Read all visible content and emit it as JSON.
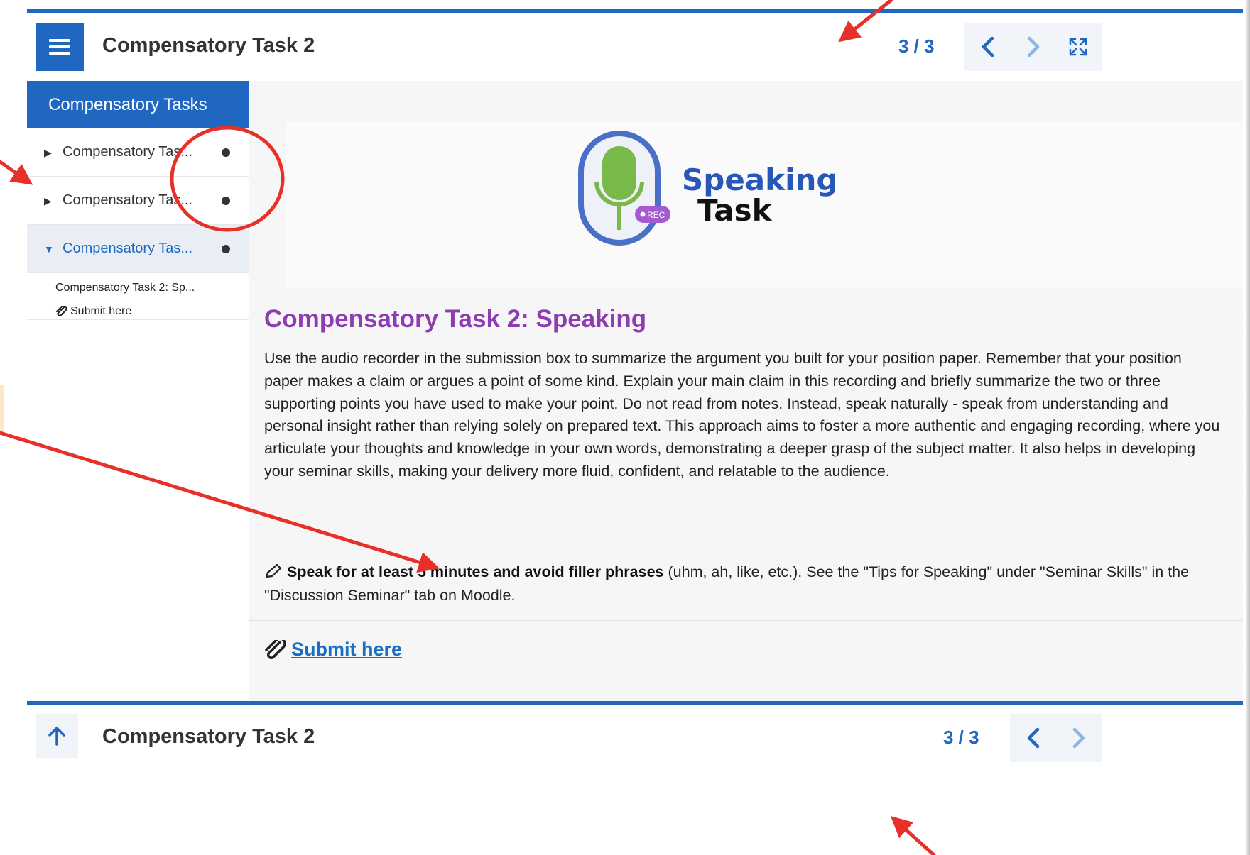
{
  "header": {
    "menu_icon": "hamburger-menu-icon",
    "title": "Compensatory Task 2",
    "page_indicator": "3 / 3",
    "prev_icon": "chevron-left-icon",
    "next_icon": "chevron-right-icon",
    "fullscreen_icon": "expand-arrows-icon"
  },
  "sidebar": {
    "heading": "Compensatory Tasks",
    "items": [
      {
        "label": "Compensatory Tas...",
        "expanded": false
      },
      {
        "label": "Compensatory Tas...",
        "expanded": false
      },
      {
        "label": "Compensatory Tas...",
        "expanded": true
      }
    ],
    "sub_items": [
      {
        "label": "Compensatory Task 2: Sp..."
      },
      {
        "label": "Submit here",
        "icon": "paperclip-icon"
      }
    ]
  },
  "banner": {
    "line1": "Speaking",
    "line2": "Task",
    "rec_badge": "REC"
  },
  "content": {
    "title": "Compensatory Task 2: Speaking",
    "body": "Use the audio recorder in the submission box to summarize the argument you built for your position paper. Remember that your position paper makes a claim or argues a point of some kind. Explain your main claim in this recording and briefly summarize the two or three supporting points you have used to make your point. Do not read from notes. Instead, speak naturally - speak from understanding and personal insight rather than relying solely on prepared text. This approach aims to foster a more authentic and engaging recording, where you articulate your thoughts and knowledge in your own words, demonstrating a deeper grasp of the subject matter. It also helps in developing your seminar skills, making your delivery more fluid, confident, and relatable to the audience.",
    "note_bold": "Speak for at least 5 minutes and avoid filler phrases",
    "note_rest": " (uhm, ah, like, etc.). See the \"Tips for Speaking\" under \"Seminar Skills\" in the \"Discussion Seminar\" tab on Moodle.",
    "submit_label": "Submit here"
  },
  "footer": {
    "up_icon": "arrow-up-icon",
    "title": "Compensatory Task 2",
    "page_indicator": "3 / 3"
  },
  "colors": {
    "accent": "#1f67c1",
    "title_purple": "#8e3cb1",
    "annotation_red": "#e8302a"
  }
}
